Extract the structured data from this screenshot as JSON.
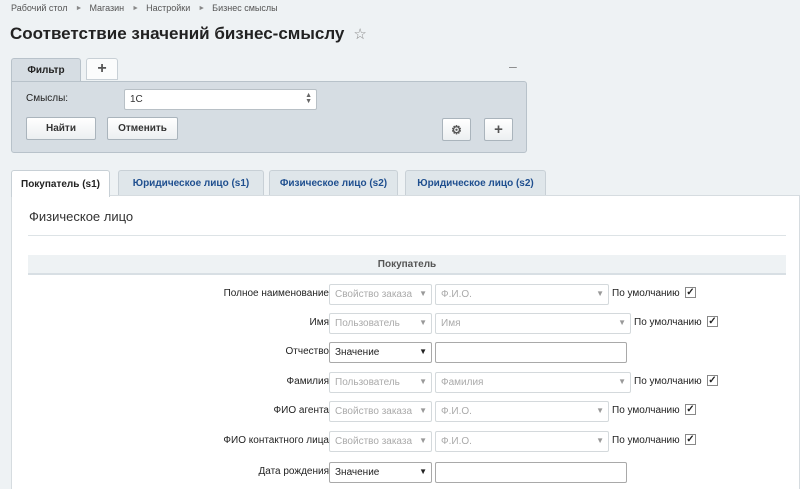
{
  "breadcrumb": [
    "Рабочий стол",
    "Магазин",
    "Настройки",
    "Бизнес смыслы"
  ],
  "page_title": "Соответствие значений бизнес-смыслу",
  "filter": {
    "tab_label": "Фильтр",
    "add_tab_label": "+",
    "collapse_label": "–",
    "field_label": "Смыслы:",
    "field_value": "1С",
    "find_label": "Найти",
    "cancel_label": "Отменить",
    "settings_icon": "⚙",
    "add_icon": "+"
  },
  "tabs": [
    {
      "label": "Покупатель (s1)",
      "active": true
    },
    {
      "label": "Юридическое лицо (s1)",
      "active": false
    },
    {
      "label": "Физическое лицо (s2)",
      "active": false
    },
    {
      "label": "Юридическое лицо (s2)",
      "active": false
    }
  ],
  "section_title": "Физическое лицо",
  "group_header": "Покупатель",
  "default_label": "По умолчанию",
  "rows": [
    {
      "label": "Полное наименование",
      "type": "Свойство заказа",
      "value": "Ф.И.О.",
      "default": true
    },
    {
      "label": "Имя",
      "type": "Пользователь",
      "value": "Имя",
      "default": true
    },
    {
      "label": "Отчество",
      "type": "Значение",
      "value": "",
      "default": false
    },
    {
      "label": "Фамилия",
      "type": "Пользователь",
      "value": "Фамилия",
      "default": true
    },
    {
      "label": "ФИО агента",
      "type": "Свойство заказа",
      "value": "Ф.И.О.",
      "default": true
    },
    {
      "label": "ФИО контактного лица",
      "type": "Свойство заказа",
      "value": "Ф.И.О.",
      "default": true
    },
    {
      "label": "Дата рождения",
      "type": "Значение",
      "value": "",
      "default": false
    }
  ]
}
